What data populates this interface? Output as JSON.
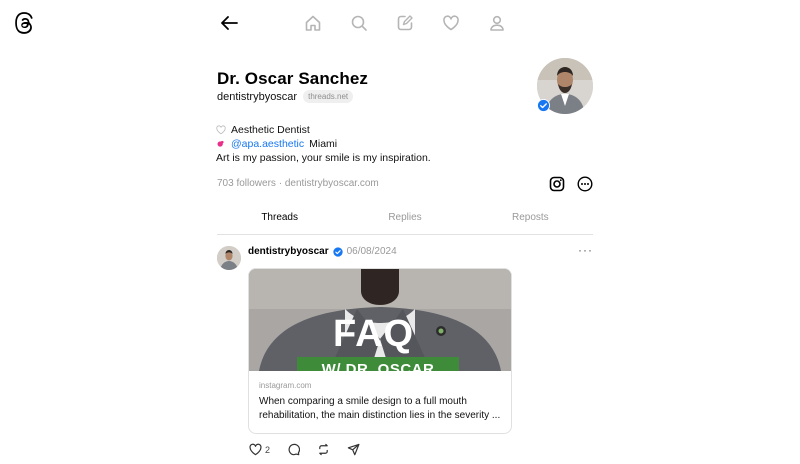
{
  "app": {
    "logo_icon": "threads-logo-icon"
  },
  "nav": {
    "icons": [
      "back-arrow-icon",
      "home-icon",
      "search-icon",
      "compose-icon",
      "heart-icon",
      "profile-icon"
    ]
  },
  "profile": {
    "name": "Dr. Oscar Sanchez",
    "handle": "dentistrybyoscar",
    "domain_pill": "threads.net",
    "bio_line1": "Aesthetic Dentist",
    "bio_mention": "@apa.aesthetic",
    "bio_line2_suffix": "Miami",
    "bio_line3": "Art is my passion, your smile is my inspiration.",
    "followers": "703 followers",
    "separator": "·",
    "website": "dentistrybyoscar.com"
  },
  "tabs": [
    {
      "label": "Threads",
      "active": true
    },
    {
      "label": "Replies",
      "active": false
    },
    {
      "label": "Reposts",
      "active": false
    }
  ],
  "post": {
    "author": "dentistrybyoscar",
    "date": "06/08/2024",
    "more": "···",
    "card": {
      "overlay_title": "FAQ",
      "overlay_banner": "W/ DR. OSCAR",
      "domain": "instagram.com",
      "text": "When comparing a smile design to a full mouth rehabilitation, the main distinction lies in the severity ..."
    },
    "likes": "2"
  },
  "colors": {
    "accent": "#1877f2",
    "banner_green": "#3e8c3a",
    "muted": "#999999"
  }
}
